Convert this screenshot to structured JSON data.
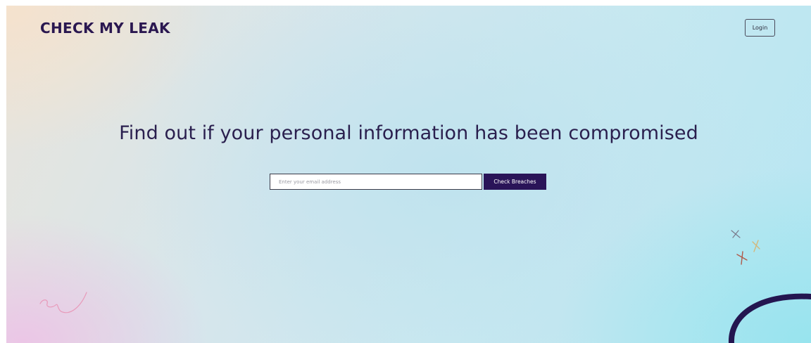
{
  "header": {
    "logo_text": "CHECK MY LEAK",
    "login_label": "Login"
  },
  "hero": {
    "headline": "Find out if your personal information has been compromised",
    "search": {
      "placeholder": "Enter your email address",
      "value": "",
      "button_label": "Check Breaches"
    }
  },
  "colors": {
    "brand": "#2a1750",
    "button_bg": "#2a1458",
    "arc": "#241650",
    "sparkle_gray": "#7a7a8a",
    "sparkle_gold": "#d4b87a",
    "sparkle_red": "#b05a4a",
    "squiggle_pink": "#e89aba"
  },
  "decorations": {
    "sparkles": [
      "sparkle-icon",
      "sparkle-icon",
      "sparkle-icon"
    ],
    "squiggle": "squiggle-doodle",
    "arc": "arc-shape"
  }
}
